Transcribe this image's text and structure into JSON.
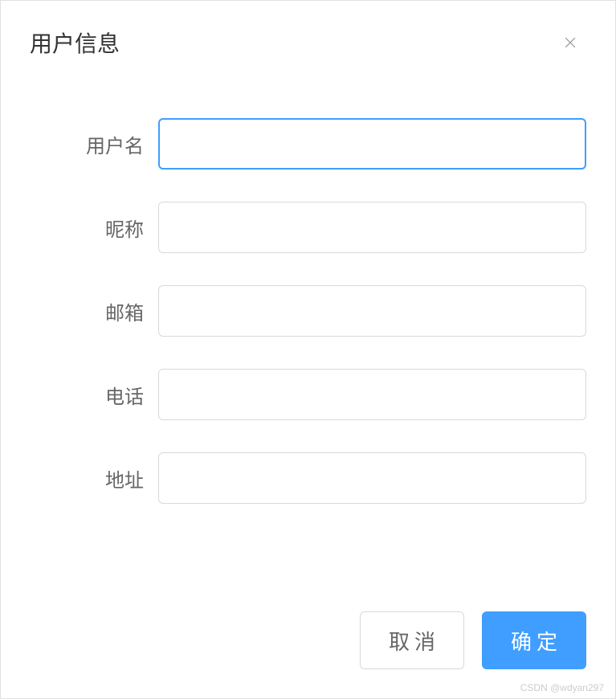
{
  "dialog": {
    "title": "用户信息"
  },
  "form": {
    "fields": [
      {
        "label": "用户名",
        "value": "",
        "focused": true
      },
      {
        "label": "昵称",
        "value": "",
        "focused": false
      },
      {
        "label": "邮箱",
        "value": "",
        "focused": false
      },
      {
        "label": "电话",
        "value": "",
        "focused": false
      },
      {
        "label": "地址",
        "value": "",
        "focused": false
      }
    ]
  },
  "footer": {
    "cancel_label": "取消",
    "confirm_label": "确定"
  },
  "watermark": "CSDN @wdyan297"
}
